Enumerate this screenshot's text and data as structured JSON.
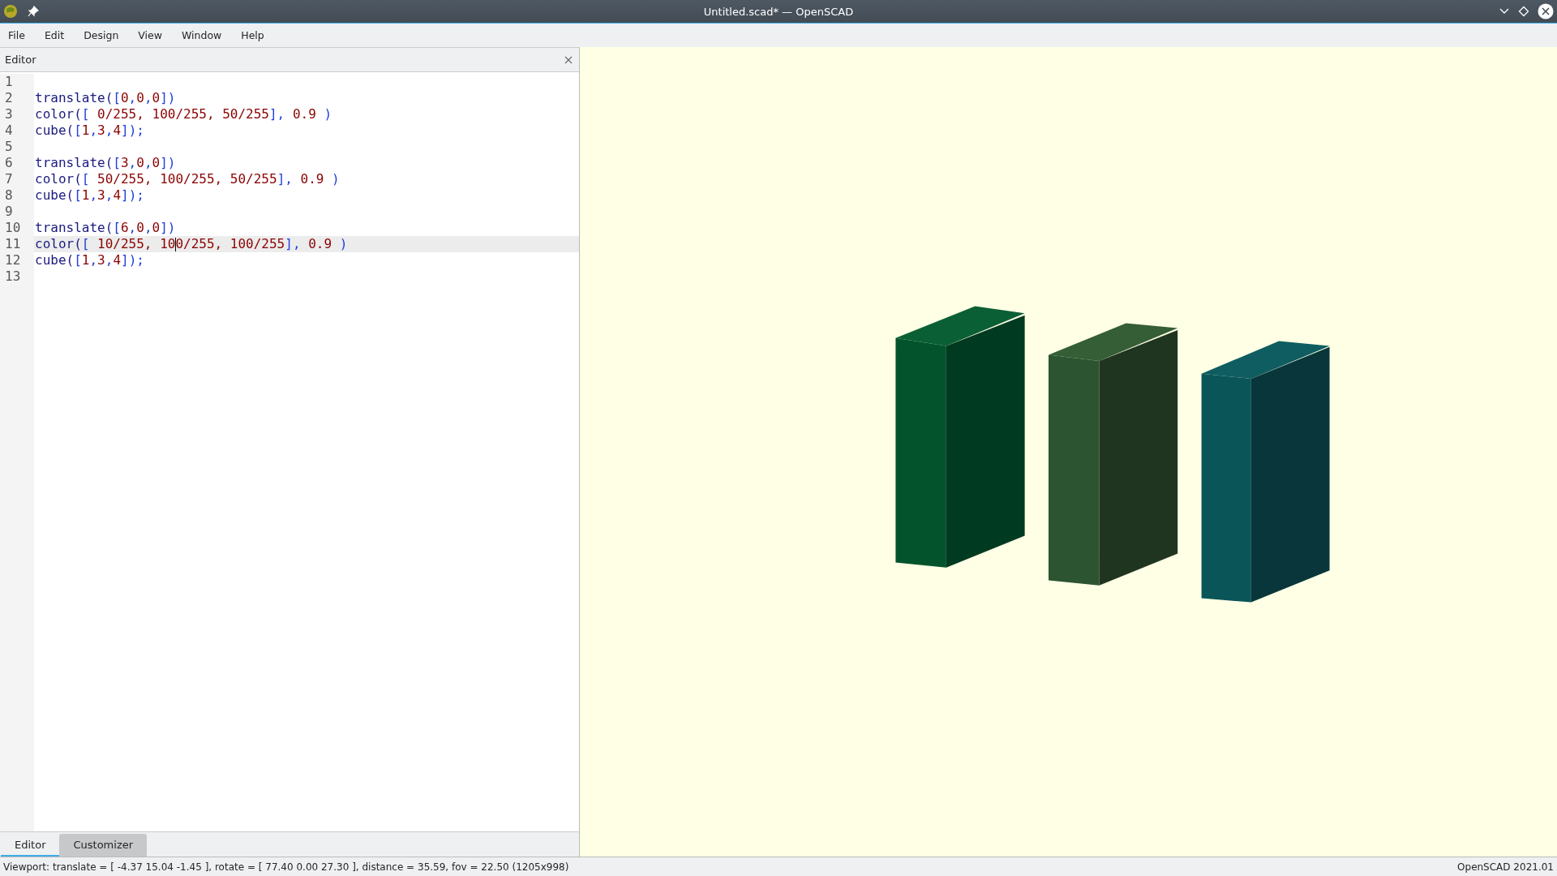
{
  "window": {
    "title": "Untitled.scad* — OpenSCAD"
  },
  "menu": [
    "File",
    "Edit",
    "Design",
    "View",
    "Window",
    "Help"
  ],
  "editor": {
    "title": "Editor",
    "lines": [
      {
        "number": "1",
        "current": false
      },
      {
        "number": "2",
        "current": false,
        "tokens": [
          {
            "text": "translate(",
            "kind": "keyword"
          },
          {
            "text": "[",
            "kind": "bracket"
          },
          {
            "text": "0",
            "kind": "number"
          },
          {
            "text": ",",
            "kind": "bracket"
          },
          {
            "text": "0",
            "kind": "number"
          },
          {
            "text": ",",
            "kind": "bracket"
          },
          {
            "text": "0",
            "kind": "number"
          },
          {
            "text": "])",
            "kind": "bracket"
          }
        ]
      },
      {
        "number": "3",
        "current": false,
        "tokens": [
          {
            "text": "color(",
            "kind": "keyword"
          },
          {
            "text": "[ ",
            "kind": "bracket"
          },
          {
            "text": "0/255, 100/255, 50/255",
            "kind": "number"
          },
          {
            "text": "], ",
            "kind": "bracket"
          },
          {
            "text": "0.9",
            "kind": "number"
          },
          {
            "text": " )",
            "kind": "bracket"
          }
        ]
      },
      {
        "number": "4",
        "current": false,
        "tokens": [
          {
            "text": "cube(",
            "kind": "keyword"
          },
          {
            "text": "[",
            "kind": "bracket"
          },
          {
            "text": "1",
            "kind": "number"
          },
          {
            "text": ",",
            "kind": "bracket"
          },
          {
            "text": "3",
            "kind": "number"
          },
          {
            "text": ",",
            "kind": "bracket"
          },
          {
            "text": "4",
            "kind": "number"
          },
          {
            "text": "]);",
            "kind": "bracket"
          }
        ]
      },
      {
        "number": "5",
        "current": false
      },
      {
        "number": "6",
        "current": false,
        "tokens": [
          {
            "text": "translate(",
            "kind": "keyword"
          },
          {
            "text": "[",
            "kind": "bracket"
          },
          {
            "text": "3",
            "kind": "number"
          },
          {
            "text": ",",
            "kind": "bracket"
          },
          {
            "text": "0",
            "kind": "number"
          },
          {
            "text": ",",
            "kind": "bracket"
          },
          {
            "text": "0",
            "kind": "number"
          },
          {
            "text": "])",
            "kind": "bracket"
          }
        ]
      },
      {
        "number": "7",
        "current": false,
        "tokens": [
          {
            "text": "color(",
            "kind": "keyword"
          },
          {
            "text": "[ ",
            "kind": "bracket"
          },
          {
            "text": "50/255, 100/255, 50/255",
            "kind": "number"
          },
          {
            "text": "], ",
            "kind": "bracket"
          },
          {
            "text": "0.9",
            "kind": "number"
          },
          {
            "text": " )",
            "kind": "bracket"
          }
        ]
      },
      {
        "number": "8",
        "current": false,
        "tokens": [
          {
            "text": "cube(",
            "kind": "keyword"
          },
          {
            "text": "[",
            "kind": "bracket"
          },
          {
            "text": "1",
            "kind": "number"
          },
          {
            "text": ",",
            "kind": "bracket"
          },
          {
            "text": "3",
            "kind": "number"
          },
          {
            "text": ",",
            "kind": "bracket"
          },
          {
            "text": "4",
            "kind": "number"
          },
          {
            "text": "]);",
            "kind": "bracket"
          }
        ]
      },
      {
        "number": "9",
        "current": false
      },
      {
        "number": "10",
        "current": false,
        "tokens": [
          {
            "text": "translate(",
            "kind": "keyword"
          },
          {
            "text": "[",
            "kind": "bracket"
          },
          {
            "text": "6",
            "kind": "number"
          },
          {
            "text": ",",
            "kind": "bracket"
          },
          {
            "text": "0",
            "kind": "number"
          },
          {
            "text": ",",
            "kind": "bracket"
          },
          {
            "text": "0",
            "kind": "number"
          },
          {
            "text": "])",
            "kind": "bracket"
          }
        ]
      },
      {
        "number": "11",
        "current": true,
        "tokens": [
          {
            "text": "color(",
            "kind": "keyword"
          },
          {
            "text": "[ ",
            "kind": "bracket"
          },
          {
            "text": "10/255, 10",
            "kind": "number",
            "caret_after": true
          },
          {
            "text": "0/255, 100/255",
            "kind": "number"
          },
          {
            "text": "], ",
            "kind": "bracket"
          },
          {
            "text": "0.9",
            "kind": "number"
          },
          {
            "text": " )",
            "kind": "bracket"
          }
        ]
      },
      {
        "number": "12",
        "current": false,
        "tokens": [
          {
            "text": "cube(",
            "kind": "keyword"
          },
          {
            "text": "[",
            "kind": "bracket"
          },
          {
            "text": "1",
            "kind": "number"
          },
          {
            "text": ",",
            "kind": "bracket"
          },
          {
            "text": "3",
            "kind": "number"
          },
          {
            "text": ",",
            "kind": "bracket"
          },
          {
            "text": "4",
            "kind": "number"
          },
          {
            "text": "]);",
            "kind": "bracket"
          }
        ]
      },
      {
        "number": "13",
        "current": false
      }
    ]
  },
  "bottom_tabs": [
    {
      "label": "Editor",
      "selected": true
    },
    {
      "label": "Customizer",
      "selected": false
    }
  ],
  "status_bar": {
    "viewport": "Viewport: translate = [ -4.37 15.04 -1.45 ], rotate = [ 77.40 0.00 27.30 ], distance = 35.59, fov = 22.50 (1205x998)",
    "version": "OpenSCAD 2021.01"
  }
}
